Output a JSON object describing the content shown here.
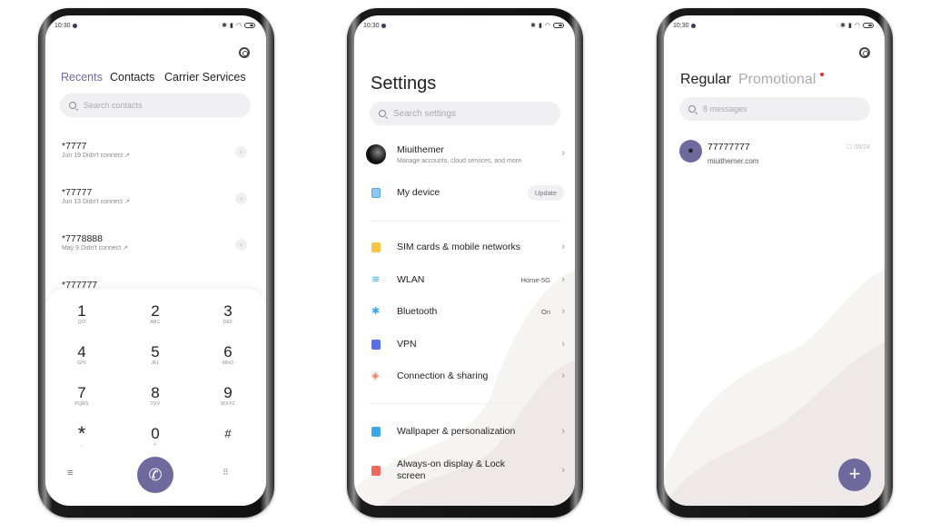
{
  "status": {
    "time": "10:30"
  },
  "dialer": {
    "tabs": [
      {
        "label": "Recents",
        "active": true
      },
      {
        "label": "Contacts"
      },
      {
        "label": "Carrier Services"
      }
    ],
    "search_placeholder": "Search contacts",
    "recents": [
      {
        "number": "*7777",
        "detail": "Jun 19 Didn't connect"
      },
      {
        "number": "*77777",
        "detail": "Jun 13 Didn't connect"
      },
      {
        "number": "*7778888",
        "detail": "May 9 Didn't connect"
      },
      {
        "number": "*777777",
        "detail": ""
      }
    ],
    "keys": [
      {
        "digit": "1",
        "letters": "QO"
      },
      {
        "digit": "2",
        "letters": "ABC"
      },
      {
        "digit": "3",
        "letters": "DEF"
      },
      {
        "digit": "4",
        "letters": "GHI"
      },
      {
        "digit": "5",
        "letters": "JKL"
      },
      {
        "digit": "6",
        "letters": "MNO"
      },
      {
        "digit": "7",
        "letters": "PQRS"
      },
      {
        "digit": "8",
        "letters": "TUV"
      },
      {
        "digit": "9",
        "letters": "WXYZ"
      },
      {
        "digit": "*",
        "letters": ","
      },
      {
        "digit": "0",
        "letters": "+"
      },
      {
        "digit": "#",
        "letters": ""
      }
    ],
    "accent": "#6e6a9e"
  },
  "settings": {
    "title": "Settings",
    "search_placeholder": "Search settings",
    "account": {
      "name": "Miuithemer",
      "subtitle": "Manage accounts, cloud services, and more"
    },
    "my_device": {
      "label": "My device",
      "badge": "Update"
    },
    "items": [
      {
        "label": "SIM cards & mobile networks",
        "value": "",
        "icon": "sim-card-icon",
        "color": "#f7c544"
      },
      {
        "label": "WLAN",
        "value": "Home-5G",
        "icon": "wifi-icon",
        "color": "#3aa8e8"
      },
      {
        "label": "Bluetooth",
        "value": "On",
        "icon": "bluetooth-icon",
        "color": "#3aa8e8"
      },
      {
        "label": "VPN",
        "value": "",
        "icon": "vpn-icon",
        "color": "#5a6ee8"
      },
      {
        "label": "Connection & sharing",
        "value": "",
        "icon": "connection-sharing-icon",
        "color": "#ee7a5a"
      },
      {
        "label": "Wallpaper & personalization",
        "value": "",
        "icon": "wallpaper-icon",
        "color": "#3aa8e8"
      },
      {
        "label": "Always-on display & Lock screen",
        "value": "",
        "icon": "lock-icon",
        "color": "#ef6a5a"
      }
    ]
  },
  "messages": {
    "tabs": [
      {
        "label": "Regular",
        "active": true
      },
      {
        "label": "Promotional",
        "has_dot": true
      }
    ],
    "search_placeholder": "8 messages",
    "threads": [
      {
        "sender": "77777777",
        "preview": "miuithemer.com",
        "date": "06/24"
      }
    ],
    "accent": "#6e6a9e"
  }
}
